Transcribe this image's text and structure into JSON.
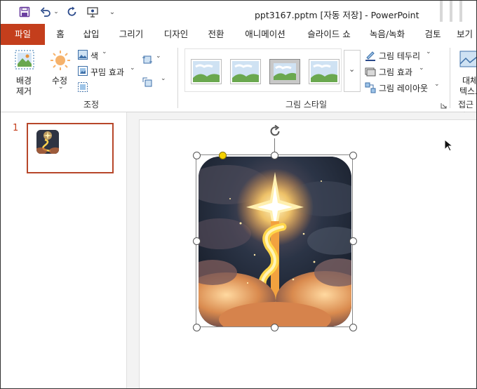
{
  "window": {
    "title": "ppt3167.pptm [자동 저장]  -  PowerPoint"
  },
  "quick_access": [
    {
      "name": "save-icon",
      "glyph": "💾"
    },
    {
      "name": "undo-icon",
      "glyph": "↶"
    },
    {
      "name": "redo-icon",
      "glyph": "↻"
    },
    {
      "name": "present-from-start-icon",
      "glyph": "⊙"
    },
    {
      "name": "customize-qat-icon",
      "glyph": "⌄"
    }
  ],
  "tabs": [
    {
      "id": "file",
      "label": "파일"
    },
    {
      "id": "home",
      "label": "홈"
    },
    {
      "id": "insert",
      "label": "삽입"
    },
    {
      "id": "draw",
      "label": "그리기"
    },
    {
      "id": "design",
      "label": "디자인"
    },
    {
      "id": "transitions",
      "label": "전환"
    },
    {
      "id": "animations",
      "label": "애니메이션"
    },
    {
      "id": "slideshow",
      "label": "슬라이드 쇼"
    },
    {
      "id": "record",
      "label": "녹음/녹화"
    },
    {
      "id": "review",
      "label": "검토"
    },
    {
      "id": "view",
      "label": "보기"
    }
  ],
  "ribbon": {
    "remove_background": {
      "line1": "배경",
      "line2": "제거"
    },
    "corrections": "수정",
    "color": "색",
    "artistic_effects": "꾸밈 효과",
    "adjust_group": "조정",
    "picture_border": "그림 테두리",
    "picture_effects": "그림 효과",
    "picture_layout": "그림 레이아웃",
    "picture_styles_group": "그림 스타일",
    "alt_text": {
      "line1": "대체",
      "line2": "텍스트"
    },
    "accessibility_group": "접근성"
  },
  "slides_pane": {
    "slide_number": "1"
  },
  "colors": {
    "file_tab": "#c43e1c",
    "selection_border": "#b7472a",
    "accent_icon": "#2b4a8b"
  }
}
